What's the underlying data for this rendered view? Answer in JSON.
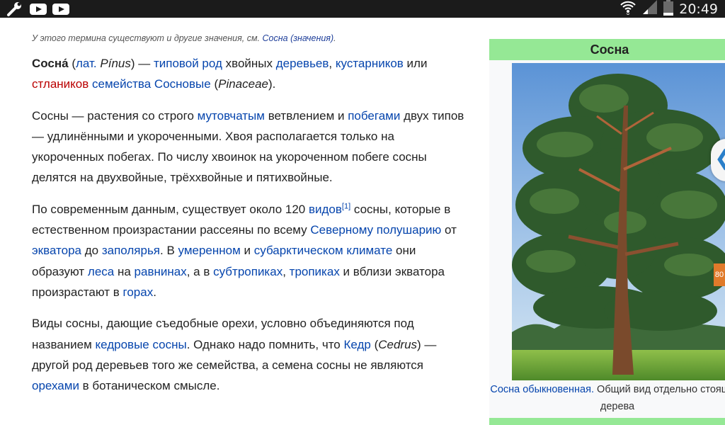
{
  "status_bar": {
    "icons_left": [
      "wrench-icon",
      "youtube-icon",
      "youtube-icon"
    ],
    "icons_right": [
      "wifi-icon",
      "signal-icon",
      "battery-icon"
    ],
    "time": "20:49"
  },
  "hatnote": {
    "prefix": "У этого термина существуют и другие значения, см.",
    "link": "Сосна (значения)",
    "suffix": "."
  },
  "intro": {
    "term": "Сосна́",
    "t1": " (",
    "lat_link": "лат.",
    "lat_name": " Pínus",
    "t2": ") — ",
    "link_type_genus": "типовой род",
    "t3": " хвойных ",
    "link_trees": "деревьев",
    "t4": ", ",
    "link_shrubs": "кустарников",
    "t5": " или ",
    "link_stlaniki": "стлаников",
    "t6": " ",
    "link_family": "семейства Сосновые",
    "t7": " (",
    "family_lat": "Pinaceae",
    "t8": ")."
  },
  "para2": {
    "t1": "Сосны — растения со строго ",
    "link_whorled": "мутовчатым",
    "t2": " ветвлением и ",
    "link_shoots": "побегами",
    "t3": " двух типов — удлинёнными и укороченными. Хвоя располагается только на укороченных побегах. По числу хвоинок на укороченном побеге сосны делятся на двухвойные, трёххвойные и пятихвойные."
  },
  "para3": {
    "t1": "По современным данным, существует около 120 ",
    "link_species": "видов",
    "ref": "[1]",
    "t2": " сосны, которые в естественном произрастании рассеяны по всему ",
    "link_north": "Северному полушарию",
    "t3": " от ",
    "link_equator": "экватора",
    "t4": " до ",
    "link_polar": "заполярья",
    "t5": ". В ",
    "link_temperate": "умеренном",
    "t6": " и ",
    "link_subarctic": "субарктическом климате",
    "t7": " они образуют ",
    "link_forests": "леса",
    "t8": " на ",
    "link_plains": "равнинах",
    "t9": ", а в ",
    "link_subtropics": "субтропиках",
    "t10": ", ",
    "link_tropics": "тропиках",
    "t11": " и вблизи экватора произрастают в ",
    "link_mountains": "горах",
    "t12": "."
  },
  "para4": {
    "t1": "Виды сосны, дающие съедобные орехи, условно объединяются под названием ",
    "link_cedar_pines": "кедровые сосны",
    "t2": ". Однако надо помнить, что ",
    "link_cedrus": "Кедр",
    "t3": " (",
    "cedrus_lat": "Cedrus",
    "t4": ") — другой род деревьев того же семейства, а семена сосны не являются ",
    "link_nuts": "орехами",
    "t5": " в ботаническом смысле."
  },
  "infobox": {
    "title": "Сосна",
    "caption_link": "Сосна обыкновенная.",
    "caption_text": " Общий вид отдельно стоящего дерева"
  },
  "edge": {
    "chevron": "❮",
    "number": "80"
  },
  "colors": {
    "link": "#0645ad",
    "redlink": "#ba0000",
    "infobox_header": "#95e895"
  }
}
